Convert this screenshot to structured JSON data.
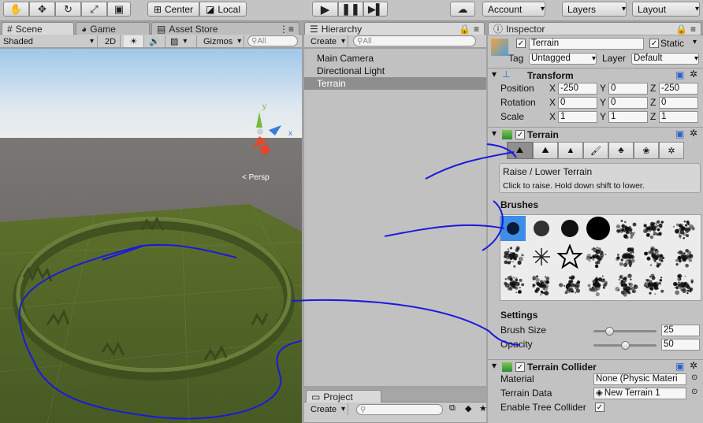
{
  "toolbar": {
    "center_label": "Center",
    "local_label": "Local",
    "account_label": "Account",
    "layers_label": "Layers",
    "layout_label": "Layout"
  },
  "scene_panel": {
    "tabs": [
      {
        "label": "Scene"
      },
      {
        "label": "Game"
      },
      {
        "label": "Asset Store"
      }
    ],
    "shading_mode": "Shaded",
    "mode_2d": "2D",
    "gizmos_label": "Gizmos",
    "search_placeholder": "All",
    "persp_label": "< Persp",
    "axis_y": "y",
    "axis_x": "x"
  },
  "hierarchy_panel": {
    "tab_label": "Hierarchy",
    "create_label": "Create",
    "search_placeholder": "All",
    "items": [
      {
        "label": "Main Camera"
      },
      {
        "label": "Directional Light"
      },
      {
        "label": "Terrain"
      }
    ]
  },
  "project_panel": {
    "tab_label": "Project",
    "create_label": "Create"
  },
  "inspector": {
    "tab_label": "Inspector",
    "object_name": "Terrain",
    "static_label": "Static",
    "tag_label": "Tag",
    "tag_value": "Untagged",
    "layer_label": "Layer",
    "layer_value": "Default",
    "transform": {
      "title": "Transform",
      "position_label": "Position",
      "rotation_label": "Rotation",
      "scale_label": "Scale",
      "x": "X",
      "y": "Y",
      "z": "Z",
      "position": [
        "-250",
        "0",
        "-250"
      ],
      "rotation": [
        "0",
        "0",
        "0"
      ],
      "scale": [
        "1",
        "1",
        "1"
      ]
    },
    "terrain": {
      "title": "Terrain",
      "tool_title": "Raise / Lower Terrain",
      "tool_hint": "Click to raise. Hold down shift to lower.",
      "brushes_label": "Brushes",
      "settings_label": "Settings",
      "brush_size_label": "Brush Size",
      "brush_size_value": "25",
      "brush_size_level": 0.25,
      "opacity_label": "Opacity",
      "opacity_value": "50",
      "opacity_level": 0.5
    },
    "collider": {
      "title": "Terrain Collider",
      "material_label": "Material",
      "material_value": "None (Physic Materi",
      "data_label": "Terrain Data",
      "data_value": "New Terrain 1",
      "tree_label": "Enable Tree Collider"
    }
  },
  "colors": {
    "annotation": "#1a1adc",
    "selection": "#8e8e8e",
    "grass": "#5a6e2e"
  }
}
